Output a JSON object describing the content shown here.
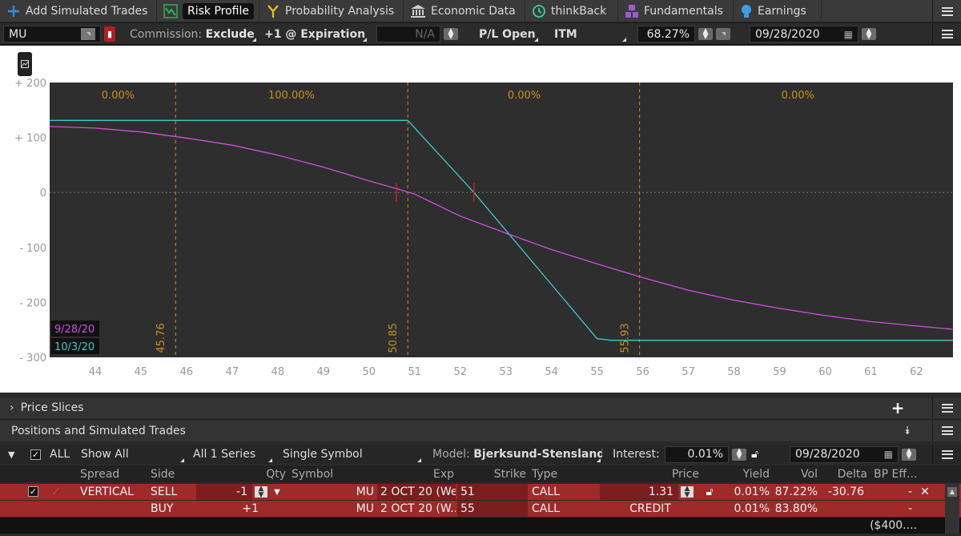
{
  "tabs": [
    {
      "label": "Add Simulated Trades",
      "icon": "plus-icon"
    },
    {
      "label": "Risk Profile",
      "icon": "risk-profile-icon"
    },
    {
      "label": "Probability Analysis",
      "icon": "probability-icon"
    },
    {
      "label": "Economic Data",
      "icon": "bank-icon"
    },
    {
      "label": "thinkBack",
      "icon": "history-icon"
    },
    {
      "label": "Fundamentals",
      "icon": "fundamentals-icon"
    },
    {
      "label": "Earnings",
      "icon": "lightbulb-icon"
    }
  ],
  "controls": {
    "symbol": "MU",
    "commission_label": "Commission:",
    "commission_value": "Exclude",
    "expiration": "+1 @ Expiration",
    "na_value": "N/A",
    "pl_mode": "P/L Open",
    "itm": "ITM",
    "probability": "68.27%",
    "date": "09/28/2020"
  },
  "chart_data": {
    "type": "line",
    "ylim": [
      -300,
      200
    ],
    "xlim": [
      43.0,
      62.8
    ],
    "yticks": [
      "+ 200",
      "+ 100",
      "0",
      "- 100",
      "- 200",
      "- 300"
    ],
    "ytick_values": [
      200,
      100,
      0,
      -100,
      -200,
      -300
    ],
    "xticks": [
      44,
      45,
      46,
      47,
      48,
      49,
      50,
      51,
      52,
      53,
      54,
      55,
      56,
      57,
      58,
      59,
      60,
      61,
      62
    ],
    "grid": false,
    "vlines": [
      {
        "x": 45.76,
        "label": "45.76"
      },
      {
        "x": 50.85,
        "label": "50.85"
      },
      {
        "x": 55.93,
        "label": "55.93"
      }
    ],
    "zones": [
      {
        "center": 44.5,
        "label": "0.00%"
      },
      {
        "center": 48.3,
        "label": "100.00%"
      },
      {
        "center": 53.4,
        "label": "0.00%"
      },
      {
        "center": 59.4,
        "label": "0.00%"
      }
    ],
    "breakeven_markers": [
      50.6,
      52.3
    ],
    "legend_placement": "bottom-left",
    "series": [
      {
        "name": "9/28/20",
        "color": "#d050e0",
        "x": [
          43.0,
          44.0,
          45.0,
          46.0,
          47.0,
          48.0,
          49.0,
          50.0,
          50.6,
          51.0,
          52.0,
          53.0,
          54.0,
          55.0,
          56.0,
          57.0,
          58.0,
          59.0,
          60.0,
          61.0,
          62.0,
          62.8
        ],
        "y": [
          120,
          117,
          110,
          99,
          86,
          68,
          46,
          21,
          7,
          -3,
          -43,
          -74,
          -104,
          -130,
          -155,
          -178,
          -196,
          -211,
          -224,
          -235,
          -243,
          -249
        ]
      },
      {
        "name": "10/3/20",
        "color": "#40c8c8",
        "x": [
          43.0,
          50.0,
          50.85,
          52.3,
          55.0,
          55.3,
          56.0,
          62.8
        ],
        "y": [
          131,
          131,
          131,
          0,
          -266,
          -269,
          -269,
          -269
        ]
      }
    ]
  },
  "panels": {
    "price_slices": "Price Slices",
    "positions": "Positions and Simulated Trades"
  },
  "positions_toolbar": {
    "all": "ALL",
    "show_all": "Show All",
    "series": "All 1 Series",
    "single_symbol": "Single Symbol",
    "model_label": "Model:",
    "model_value": "Bjerksund-Stensland",
    "interest_label": "Interest:",
    "interest_value": "0.01%",
    "date": "09/28/2020"
  },
  "columns": [
    "Spread",
    "Side",
    "Qty",
    "Symbol",
    "Exp",
    "Strike",
    "Type",
    "Price",
    "Yield",
    "Vol",
    "Delta",
    "BP Eff..."
  ],
  "rows": [
    {
      "spread": "VERTICAL",
      "side": "SELL",
      "qty": "-1",
      "symbol": "MU",
      "exp": "2 OCT 20 (We...",
      "strike": "51",
      "type": "CALL",
      "price": "1.31",
      "yield": "0.01%",
      "vol": "87.22%",
      "delta": "-30.76",
      "bp": "-"
    },
    {
      "spread": "",
      "side": "BUY",
      "qty": "+1",
      "symbol": "MU",
      "exp": "2 OCT 20 (W...",
      "strike": "55",
      "type": "CALL",
      "price": "CREDIT",
      "yield": "0.01%",
      "vol": "83.80%",
      "delta": "",
      "bp": "-"
    }
  ],
  "totals": {
    "bp": "($400...."
  }
}
